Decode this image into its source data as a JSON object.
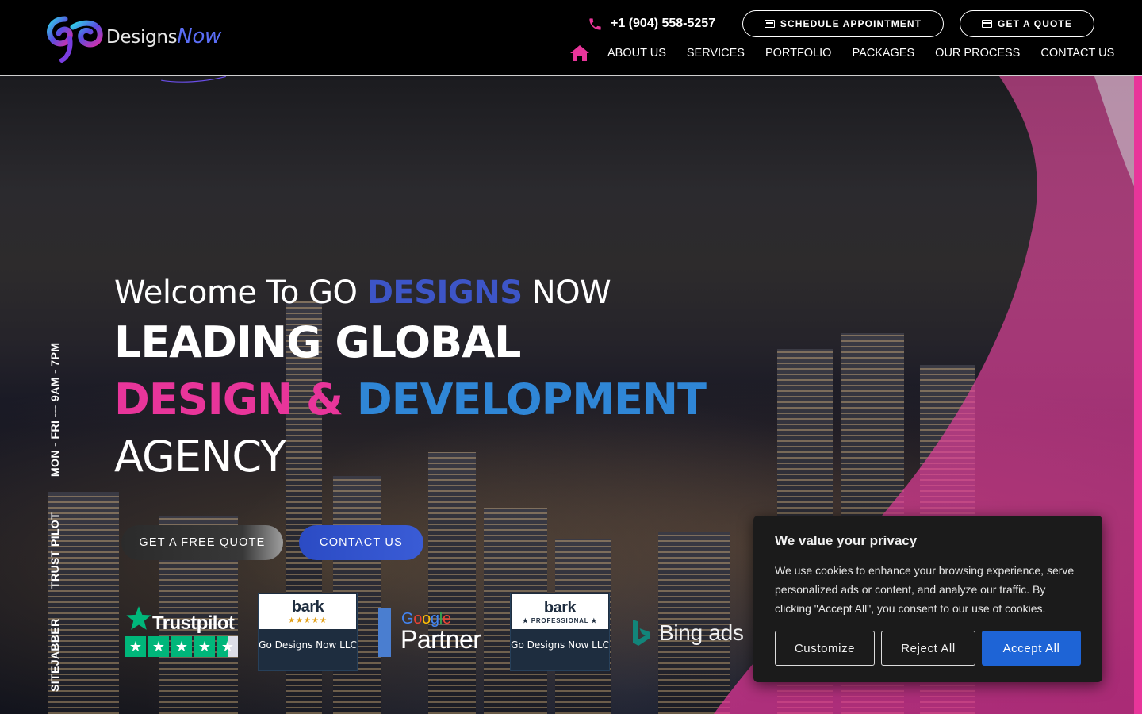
{
  "header": {
    "logo_text_main": "Designs",
    "logo_text_accent": "Now",
    "phone": "+1 (904) 558-5257",
    "schedule_label": "SCHEDULE APPOINTMENT",
    "quote_label": "GET A QUOTE",
    "nav": [
      {
        "label": "ABOUT US"
      },
      {
        "label": "SERVICES"
      },
      {
        "label": "PORTFOLIO"
      },
      {
        "label": "PACKAGES"
      },
      {
        "label": "OUR PROCESS"
      },
      {
        "label": "CONTACT US"
      }
    ]
  },
  "side": {
    "hours": "MON - FRI --- 9AM - 7PM",
    "trustpilot": "TRUST PILOT",
    "sitejabber": "SITEJABBER"
  },
  "hero": {
    "welcome_prefix": "Welcome To GO ",
    "welcome_accent": "DESIGNS",
    "welcome_suffix": " NOW",
    "line1": "LEADING GLOBAL",
    "line2_pink": "DESIGN & ",
    "line2_blue": "DEVELOPMENT",
    "line3": "AGENCY",
    "cta_quote": "GET A FREE QUOTE",
    "cta_contact": "CONTACT US"
  },
  "badges": {
    "trustpilot": "Trustpilot",
    "bark1_logo": "bark",
    "bark1_stars": "★★★★★",
    "bark1_name": "Go Designs Now LLC",
    "google_top": "Google",
    "google_bottom": "Partner",
    "bark2_logo": "bark",
    "bark2_sub": "★ PROFESSIONAL ★",
    "bark2_name": "Go Designs Now LLC",
    "bing": "Bing ads"
  },
  "cookie": {
    "title": "We value your privacy",
    "body": "We use cookies to enhance your browsing experience, serve personalized ads or content, and analyze our traffic. By clicking \"Accept All\", you consent to our use of cookies.",
    "customize": "Customize",
    "reject": "Reject All",
    "accept": "Accept All"
  },
  "colors": {
    "pink": "#e8359a",
    "blue": "#3d55c7",
    "accept": "#1e64d6",
    "trustpilot_green": "#00b67a"
  }
}
